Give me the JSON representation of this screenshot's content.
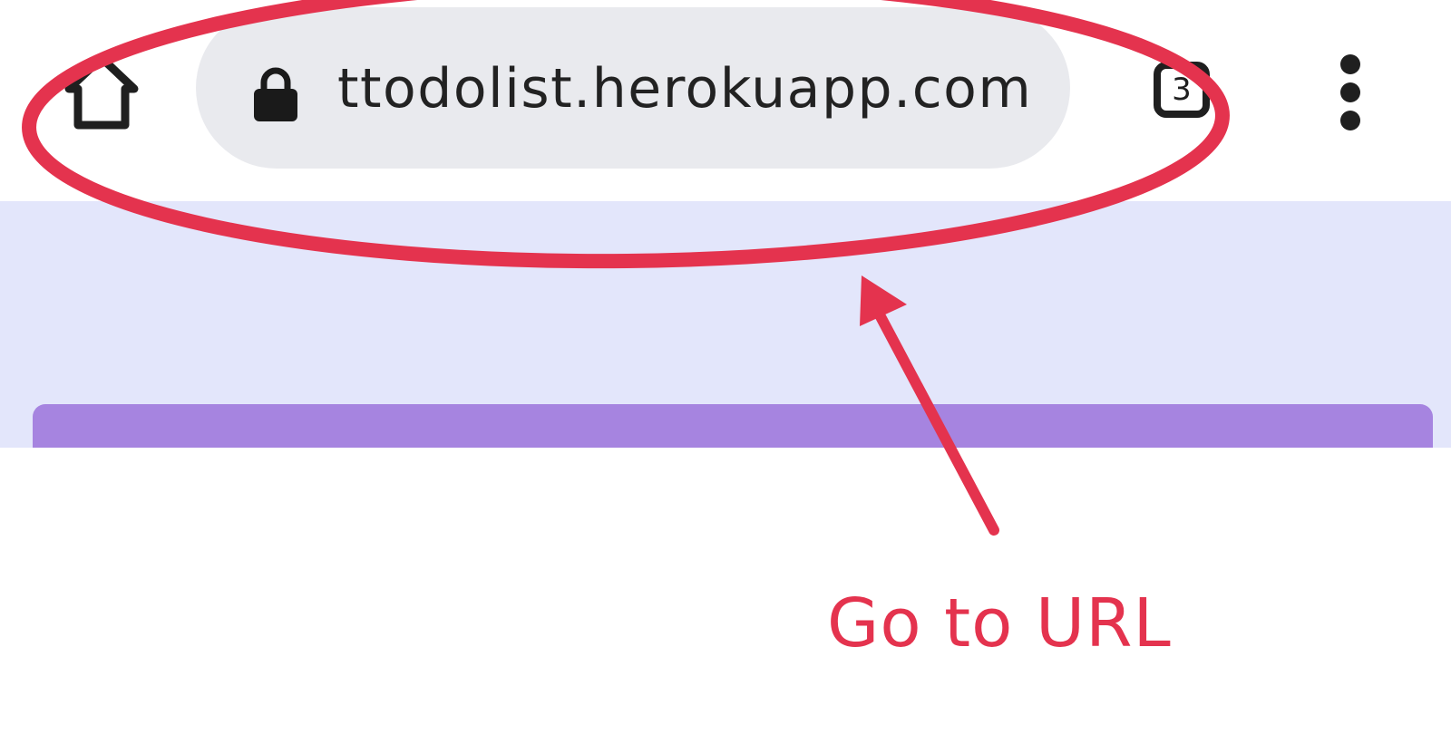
{
  "browser": {
    "url": "ttodolist.herokuapp.com",
    "tab_count": "3",
    "icons": {
      "home": "home-icon",
      "lock": "lock-icon",
      "tabs": "tab-switcher-icon",
      "menu": "more-vert-icon"
    }
  },
  "annotation": {
    "label": "Go to URL",
    "color": "#e4334e"
  },
  "colors": {
    "page_background": "#e3e6fb",
    "card_header": "#a684e0",
    "omnibox": "#e9eaee"
  }
}
